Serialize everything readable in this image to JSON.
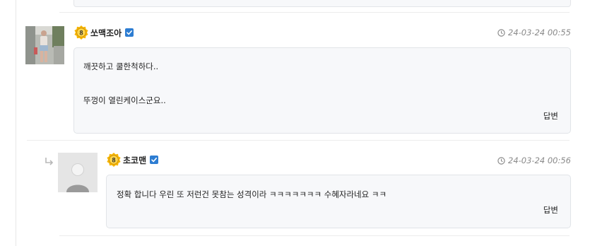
{
  "comments": [
    {
      "author": "쏘맥조아",
      "level": "8",
      "timestamp": "24-03-24 00:55",
      "lines": [
        "깨끗하고 쿨한척하다..",
        "뚜껑이 열린케이스군요.."
      ],
      "reply_label": "답변"
    },
    {
      "author": "초코맨",
      "level": "8",
      "timestamp": "24-03-24 00:56",
      "lines": [
        "정확 합니다 우린 또 저런건 못참는 성격이라 ㅋㅋㅋㅋㅋㅋㅋ 수혜자라네요 ㅋㅋ"
      ],
      "reply_label": "답변"
    }
  ],
  "colors": {
    "accent": "#2d7dd2",
    "badge": "#f5b400",
    "meta": "#8a8a8a",
    "bubble_bg": "#f7f8fa"
  },
  "icons": [
    "level-badge-icon",
    "verified-check-icon",
    "clock-icon",
    "reply-arrow-icon"
  ]
}
